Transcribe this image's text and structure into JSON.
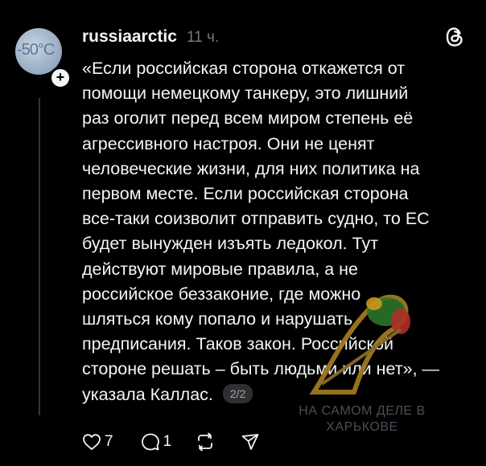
{
  "post": {
    "username": "russiaarctic",
    "timestamp": "11 ч.",
    "avatar_text": "-50°C",
    "text": "«Если российская сторона откажется от\nпомощи немецкому танкеру, это лишний\nраз оголит перед всем миром степень её\nагрессивного настроя. Они не ценят\nчеловеческие жизни, для них политика на\nпервом месте. Если российская сторона\nвсе-таки соизволит отправить судно, то ЕС\nбудет вынужден изъять ледокол. Тут\nдействуют мировые правила, а не\nроссийское беззаконие, где можно\nшляться кому попало и нарушать\nпредписания. Таков закон. Российской\nстороне решать – быть людьми или нет», —\nуказала Каллас.",
    "page_counter": "2/2"
  },
  "actions": {
    "likes": "7",
    "comments": "1"
  },
  "watermark": {
    "line1": "НА САМОМ ДЕЛЕ В",
    "line2": "ХАРЬКОВЕ"
  },
  "icons": {
    "brand": "threads-logo-icon",
    "plus": "plus-icon",
    "like": "heart-icon",
    "comment": "comment-icon",
    "repost": "repost-icon",
    "share": "send-icon"
  },
  "colors": {
    "background": "#000000",
    "text": "#f3f5f7",
    "muted": "#777777",
    "counter_bg": "#2d2f31",
    "thread_line": "#333638"
  }
}
